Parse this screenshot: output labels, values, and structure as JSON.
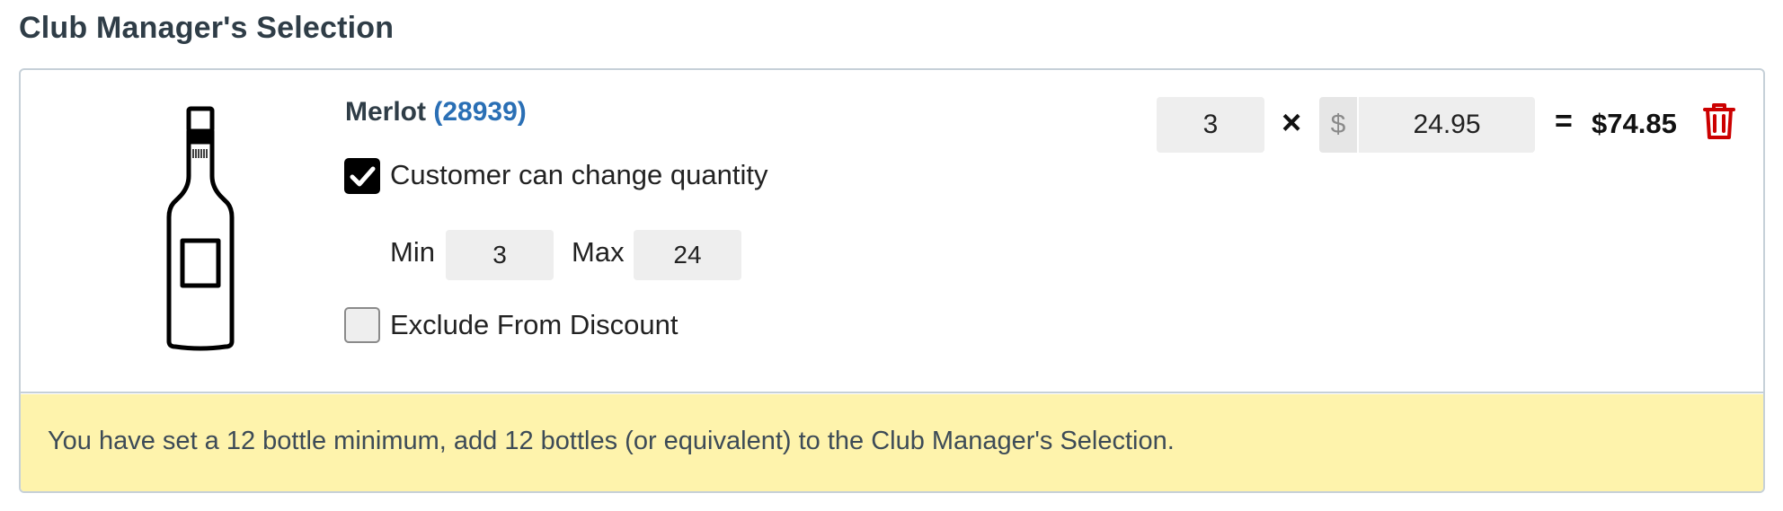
{
  "section": {
    "title": "Club Manager's Selection"
  },
  "product": {
    "name": "Merlot",
    "sku_open": "(",
    "sku": "28939",
    "sku_close": ")",
    "image_icon": "wine-bottle-icon"
  },
  "options": {
    "change_quantity": {
      "label": "Customer can change quantity",
      "checked": true
    },
    "min_label": "Min",
    "min_value": "3",
    "max_label": "Max",
    "max_value": "24",
    "exclude_discount": {
      "label": "Exclude From Discount",
      "checked": false
    }
  },
  "pricing": {
    "quantity": "3",
    "times": "×",
    "currency": "$",
    "price": "24.95",
    "equals": "=",
    "total": "$74.85",
    "delete_icon": "trash-icon",
    "delete_color": "#cc0000"
  },
  "alert": {
    "message": "You have set a 12 bottle minimum, add 12 bottles (or equivalent) to the Club Manager's Selection.",
    "background": "#fef3ac"
  }
}
